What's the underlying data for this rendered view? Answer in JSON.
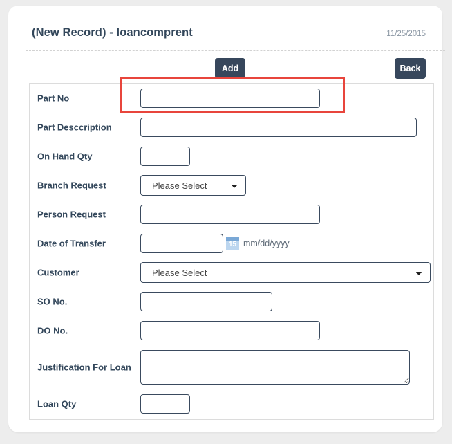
{
  "header": {
    "title": "(New Record) - loancomprent",
    "date": "11/25/2015"
  },
  "toolbar": {
    "add_label": "Add",
    "back_label": "Back"
  },
  "form": {
    "fields": [
      {
        "label": "Part No",
        "type": "text",
        "value": "",
        "placeholder": ""
      },
      {
        "label": "Part Desccription",
        "type": "text",
        "value": "",
        "placeholder": ""
      },
      {
        "label": "On Hand Qty",
        "type": "text",
        "value": "",
        "placeholder": ""
      },
      {
        "label": "Branch Request",
        "type": "select",
        "value": "Please Select",
        "options": [
          "Please Select"
        ]
      },
      {
        "label": "Person Request",
        "type": "text",
        "value": "",
        "placeholder": ""
      },
      {
        "label": "Date of Transfer",
        "type": "date",
        "value": "",
        "hint": "mm/dd/yyyy",
        "icon": "calendar-icon",
        "icon_day": "15"
      },
      {
        "label": "Customer",
        "type": "select",
        "value": "Please Select",
        "options": [
          "Please Select"
        ]
      },
      {
        "label": "SO No.",
        "type": "text",
        "value": "",
        "placeholder": ""
      },
      {
        "label": "DO No.",
        "type": "text",
        "value": "",
        "placeholder": ""
      },
      {
        "label": "Justification For Loan",
        "type": "textarea",
        "value": "",
        "placeholder": ""
      },
      {
        "label": "Loan Qty",
        "type": "text",
        "value": "",
        "placeholder": ""
      }
    ]
  },
  "annotation": {
    "highlight_color": "#e8453c",
    "target_field": "Part No"
  },
  "colors": {
    "button": "#37475c",
    "title": "#33475b",
    "page_background": "#ededed",
    "card_background": "#ffffff",
    "input_border": "#3a4a5e",
    "calendar_icon": "#7aa8d6"
  }
}
